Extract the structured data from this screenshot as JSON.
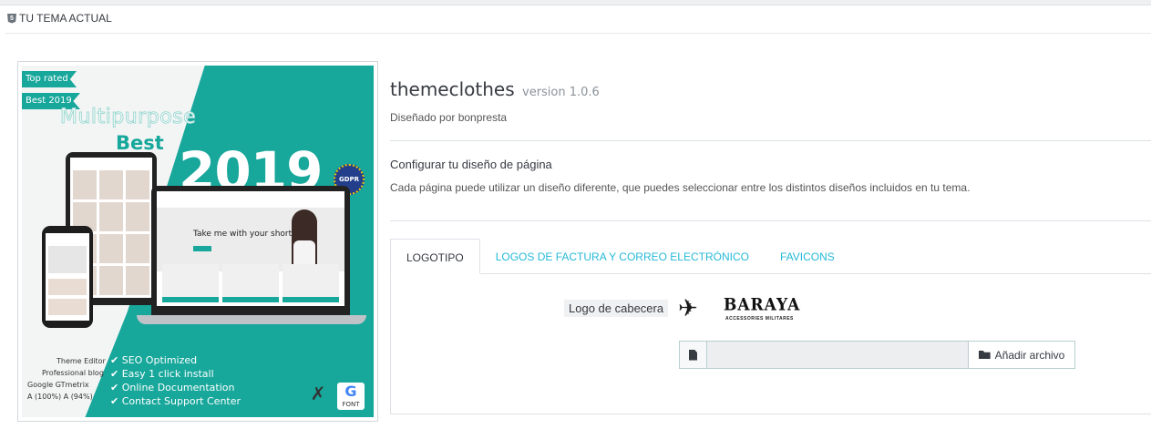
{
  "header": {
    "title": "TU TEMA ACTUAL",
    "icon": "html5-icon"
  },
  "preview": {
    "ribbons": [
      "Top rated",
      "Best 2019"
    ],
    "headline": "Multipurpose",
    "best": "Best",
    "year": "2019",
    "gdpr": "GDPR",
    "laptop_text": "Take me with your short",
    "features": [
      "SEO Optimized",
      "Easy 1 click install",
      "Online Documentation",
      "Contact Support Center"
    ],
    "side": [
      "Theme Editor",
      "Professional blog",
      "Google GTmetrix",
      "A (100%)   A (94%)"
    ],
    "font_badge": "FONT"
  },
  "theme": {
    "name": "themeclothes",
    "version": "version 1.0.6",
    "author": "Diseñado por bonpresta"
  },
  "layout": {
    "title": "Configurar tu diseño de página",
    "description": "Cada página puede utilizar un diseño diferente, que puedes seleccionar entre los distintos diseños incluidos en tu tema."
  },
  "tabs": [
    {
      "label": "LOGOTIPO",
      "active": true
    },
    {
      "label": "LOGOS DE FACTURA Y CORREO ELECTRÓNICO",
      "active": false
    },
    {
      "label": "FAVICONS",
      "active": false
    }
  ],
  "logo_section": {
    "label": "Logo de cabecera",
    "brand": "BARAYA",
    "brand_sub": "ACCESSORIES MILITARES",
    "file_input_value": "",
    "add_button": "Añadir archivo"
  },
  "colors": {
    "accent": "#25b9d7",
    "teal": "#17a79b",
    "text": "#363a41"
  }
}
